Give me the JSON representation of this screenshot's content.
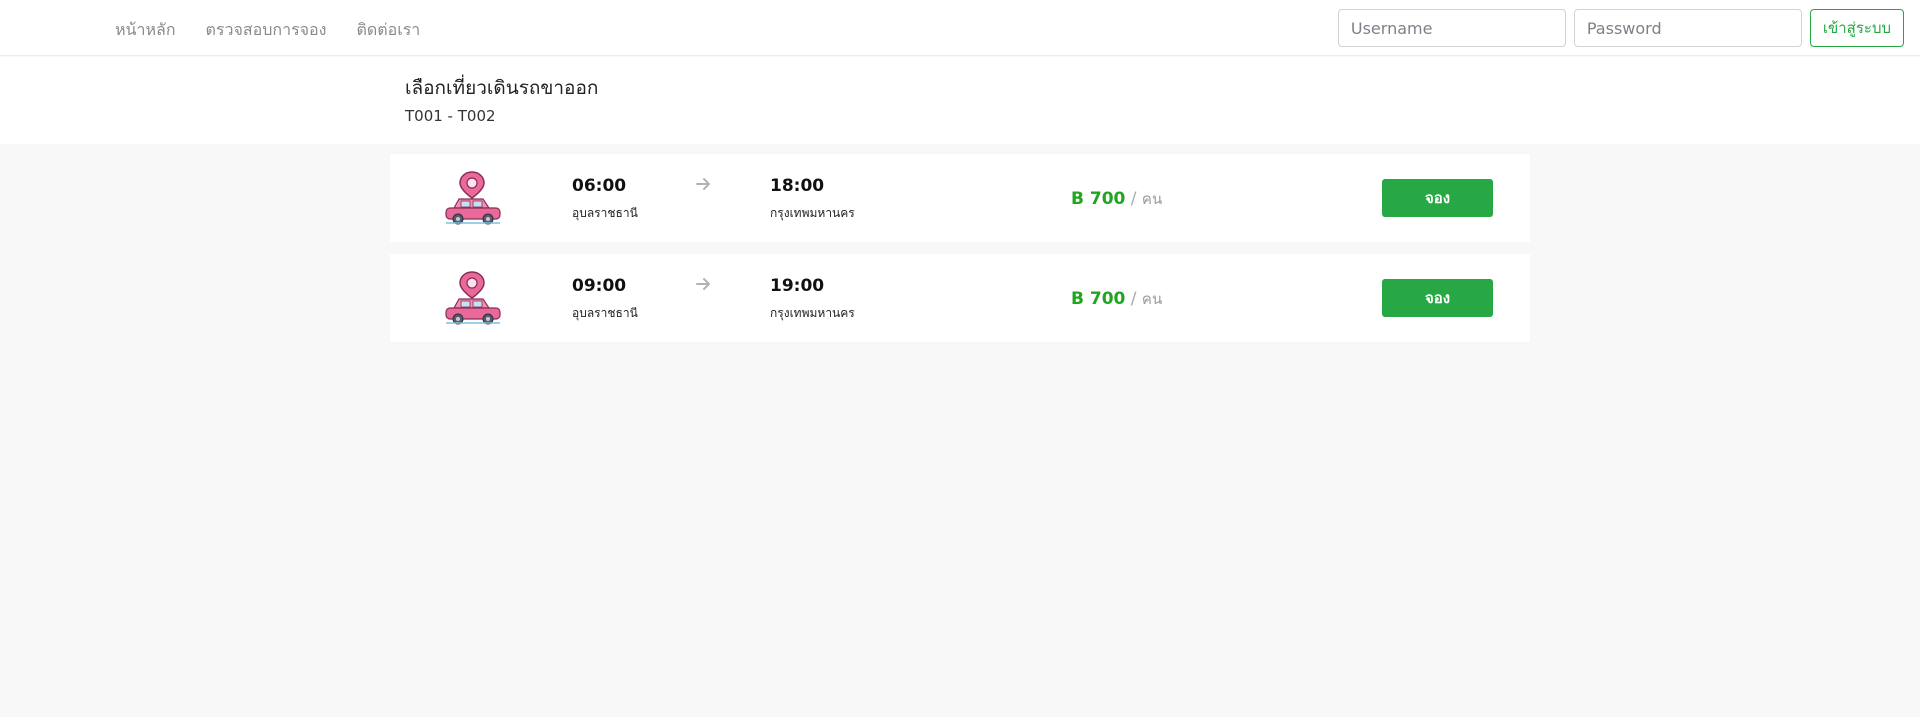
{
  "nav": {
    "links": [
      "หน้าหลัก",
      "ตรวจสอบการจอง",
      "ติดต่อเรา"
    ],
    "username_placeholder": "Username",
    "password_placeholder": "Password",
    "login_label": "เข้าสู่ระบบ"
  },
  "header": {
    "title": "เลือกเที่ยวเดินรถขาออก",
    "route_code": "T001 - T002"
  },
  "trips": [
    {
      "departure_time": "06:00",
      "departure_city": "อุบลราชธานี",
      "arrival_time": "18:00",
      "arrival_city": "กรุงเทพมหานคร",
      "price": "B 700",
      "price_separator": "/",
      "price_unit": "คน",
      "book_label": "จอง"
    },
    {
      "departure_time": "09:00",
      "departure_city": "อุบลราชธานี",
      "arrival_time": "19:00",
      "arrival_city": "กรุงเทพมหานคร",
      "price": "B 700",
      "price_separator": "/",
      "price_unit": "คน",
      "book_label": "จอง"
    }
  ],
  "colors": {
    "accent": "#28a745",
    "price": "#1fa51f",
    "car": "#e8699a",
    "page_background": "#f8f8f8"
  },
  "icons": {
    "trip_icon": "car-location-pin-icon",
    "direction_icon": "arrow-right-icon"
  }
}
